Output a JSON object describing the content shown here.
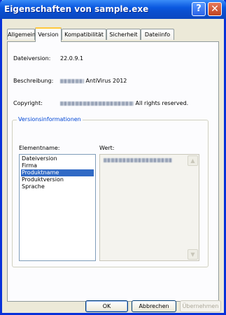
{
  "window": {
    "title": "Eigenschaften von sample.exe"
  },
  "titlebar": {
    "help_glyph": "?",
    "close_glyph": "✕"
  },
  "tabs": [
    {
      "label": "Allgemein"
    },
    {
      "label": "Version"
    },
    {
      "label": "Kompatibilität"
    },
    {
      "label": "Sicherheit"
    },
    {
      "label": "Dateiinfo"
    }
  ],
  "version": {
    "dateiversion_label": "Dateiversion:",
    "dateiversion_value": "22.0.9.1",
    "beschreibung_label": "Beschreibung:",
    "beschreibung_value": "AntiVirus 2012",
    "copyright_label": "Copyright:",
    "copyright_value": "All rights reserved."
  },
  "group": {
    "title": "Versionsinformationen",
    "col_name": "Elementname:",
    "col_value": "Wert:",
    "items": [
      {
        "label": "Dateiversion"
      },
      {
        "label": "Firma"
      },
      {
        "label": "Produktname"
      },
      {
        "label": "Produktversion"
      },
      {
        "label": "Sprache"
      }
    ],
    "selected_item": "Produktname"
  },
  "scrollbar": {
    "up_glyph": "▲",
    "down_glyph": "▼"
  },
  "buttons": {
    "ok": "OK",
    "cancel": "Abbrechen",
    "apply": "Übernehmen"
  },
  "colors": {
    "title_bar": "#0a58e0",
    "selection": "#316ac5",
    "group_title": "#0046d5",
    "tab_highlight": "#ffc83c"
  }
}
